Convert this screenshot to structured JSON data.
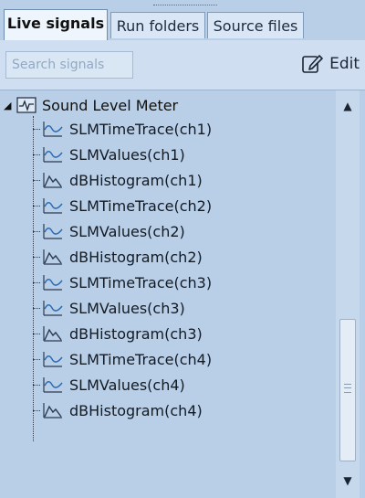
{
  "tabs": [
    {
      "label": "Live signals",
      "active": true
    },
    {
      "label": "Run folders",
      "active": false
    },
    {
      "label": "Source files",
      "active": false
    }
  ],
  "toolbar": {
    "search_placeholder": "Search signals",
    "edit_label": "Edit"
  },
  "tree": {
    "root": {
      "label": "Sound Level Meter",
      "icon": "meter-icon",
      "expanded": true
    },
    "items": [
      {
        "label": "SLMTimeTrace(ch1)",
        "icon": "time-trace-icon"
      },
      {
        "label": "SLMValues(ch1)",
        "icon": "time-trace-icon"
      },
      {
        "label": "dBHistogram(ch1)",
        "icon": "histogram-icon"
      },
      {
        "label": "SLMTimeTrace(ch2)",
        "icon": "time-trace-icon"
      },
      {
        "label": "SLMValues(ch2)",
        "icon": "time-trace-icon"
      },
      {
        "label": "dBHistogram(ch2)",
        "icon": "histogram-icon"
      },
      {
        "label": "SLMTimeTrace(ch3)",
        "icon": "time-trace-icon"
      },
      {
        "label": "SLMValues(ch3)",
        "icon": "time-trace-icon"
      },
      {
        "label": "dBHistogram(ch3)",
        "icon": "histogram-icon"
      },
      {
        "label": "SLMTimeTrace(ch4)",
        "icon": "time-trace-icon"
      },
      {
        "label": "SLMValues(ch4)",
        "icon": "time-trace-icon"
      },
      {
        "label": "dBHistogram(ch4)",
        "icon": "histogram-icon"
      }
    ]
  },
  "colors": {
    "panel_bg": "#b9cfe8",
    "tab_active_bg": "#eef5fc",
    "toolbar_bg": "#cfdff1"
  }
}
